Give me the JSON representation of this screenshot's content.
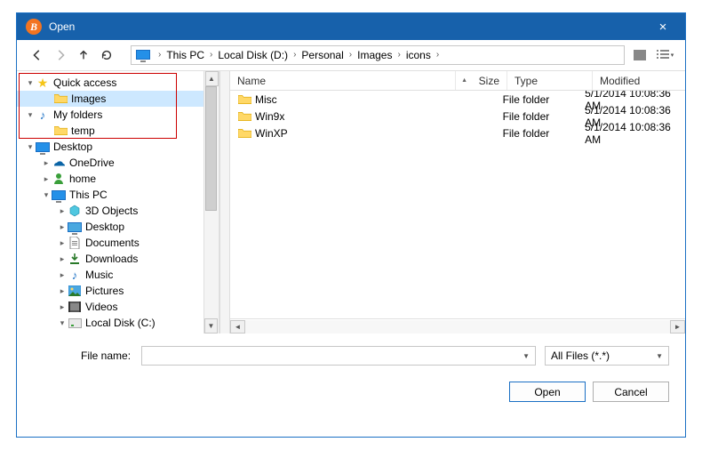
{
  "title": "Open",
  "breadcrumb": [
    "This PC",
    "Local Disk (D:)",
    "Personal",
    "Images",
    "icons"
  ],
  "tree": {
    "quick_access": "Quick access",
    "qa_images": "Images",
    "my_folders": "My folders",
    "mf_temp": "temp",
    "desktop": "Desktop",
    "onedrive": "OneDrive",
    "home": "home",
    "thispc": "This PC",
    "objects3d": "3D Objects",
    "desktop2": "Desktop",
    "documents": "Documents",
    "downloads": "Downloads",
    "music": "Music",
    "pictures": "Pictures",
    "videos": "Videos",
    "localdisk_c": "Local Disk (C:)"
  },
  "columns": {
    "name": "Name",
    "size": "Size",
    "type": "Type",
    "modified": "Modified"
  },
  "files": [
    {
      "name": "Misc",
      "size": "",
      "type": "File folder",
      "modified": "5/1/2014 10:08:36 AM"
    },
    {
      "name": "Win9x",
      "size": "",
      "type": "File folder",
      "modified": "5/1/2014 10:08:36 AM"
    },
    {
      "name": "WinXP",
      "size": "",
      "type": "File folder",
      "modified": "5/1/2014 10:08:36 AM"
    }
  ],
  "filename_label": "File name:",
  "filename_value": "",
  "filter": "All Files (*.*)",
  "buttons": {
    "open": "Open",
    "cancel": "Cancel"
  }
}
